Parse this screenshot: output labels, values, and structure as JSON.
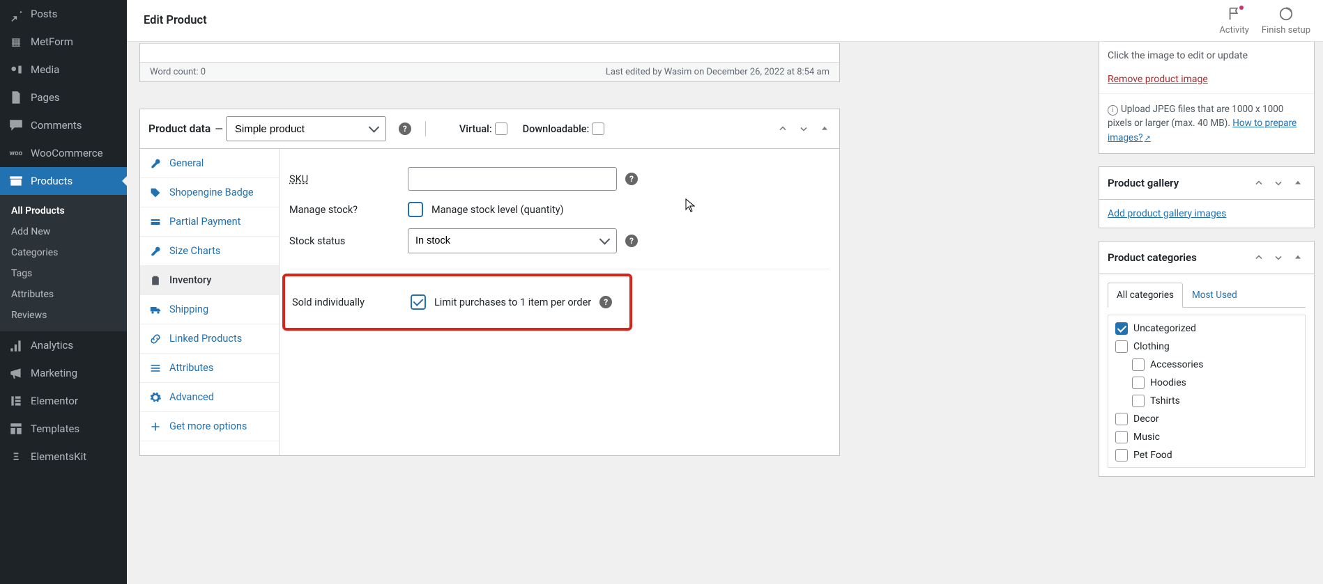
{
  "header": {
    "title": "Edit Product",
    "activity_label": "Activity",
    "finish_label": "Finish setup"
  },
  "sidebar": {
    "items": [
      {
        "label": "Posts"
      },
      {
        "label": "MetForm"
      },
      {
        "label": "Media"
      },
      {
        "label": "Pages"
      },
      {
        "label": "Comments"
      },
      {
        "label": "WooCommerce"
      },
      {
        "label": "Products"
      },
      {
        "label": "Analytics"
      },
      {
        "label": "Marketing"
      },
      {
        "label": "Elementor"
      },
      {
        "label": "Templates"
      },
      {
        "label": "ElementsKit"
      }
    ],
    "submenu": [
      {
        "label": "All Products"
      },
      {
        "label": "Add New"
      },
      {
        "label": "Categories"
      },
      {
        "label": "Tags"
      },
      {
        "label": "Attributes"
      },
      {
        "label": "Reviews"
      }
    ]
  },
  "editor_footer": {
    "word_count": "Word count: 0",
    "last_edited": "Last edited by Wasim on December 26, 2022 at 8:54 am"
  },
  "product_data": {
    "heading": "Product data",
    "type_selected": "Simple product",
    "virtual_label": "Virtual:",
    "downloadable_label": "Downloadable:",
    "tabs": [
      {
        "label": "General"
      },
      {
        "label": "Shopengine Badge"
      },
      {
        "label": "Partial Payment"
      },
      {
        "label": "Size Charts"
      },
      {
        "label": "Inventory"
      },
      {
        "label": "Shipping"
      },
      {
        "label": "Linked Products"
      },
      {
        "label": "Attributes"
      },
      {
        "label": "Advanced"
      },
      {
        "label": "Get more options"
      }
    ],
    "fields": {
      "sku_label": "SKU",
      "sku_value": "",
      "manage_label": "Manage stock?",
      "manage_desc": "Manage stock level (quantity)",
      "stock_status_label": "Stock status",
      "stock_status_value": "In stock",
      "sold_label": "Sold individually",
      "sold_desc": "Limit purchases to 1 item per order"
    }
  },
  "right": {
    "image": {
      "click_hint": "Click the image to edit or update",
      "remove_link": "Remove product image",
      "upload_hint": "Upload JPEG files that are 1000 x 1000 pixels or larger (max. 40 MB). ",
      "how_link": "How to prepare images?"
    },
    "gallery": {
      "title": "Product gallery",
      "add_link": "Add product gallery images"
    },
    "categories": {
      "title": "Product categories",
      "tab_all": "All categories",
      "tab_most": "Most Used",
      "list": [
        {
          "label": "Uncategorized",
          "checked": true,
          "indent": false
        },
        {
          "label": "Clothing",
          "checked": false,
          "indent": false
        },
        {
          "label": "Accessories",
          "checked": false,
          "indent": true
        },
        {
          "label": "Hoodies",
          "checked": false,
          "indent": true
        },
        {
          "label": "Tshirts",
          "checked": false,
          "indent": true
        },
        {
          "label": "Decor",
          "checked": false,
          "indent": false
        },
        {
          "label": "Music",
          "checked": false,
          "indent": false
        },
        {
          "label": "Pet Food",
          "checked": false,
          "indent": false
        }
      ]
    }
  }
}
